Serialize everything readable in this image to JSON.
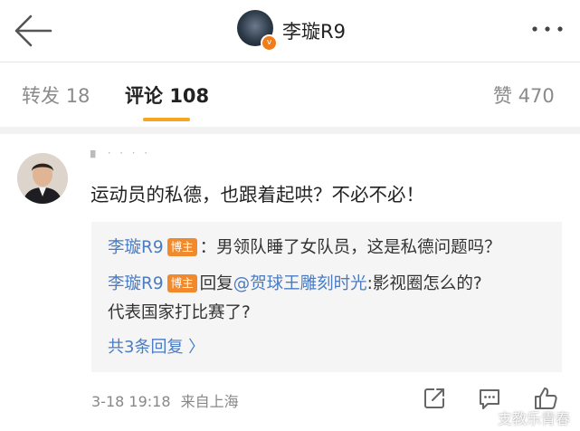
{
  "header": {
    "user_name": "李璇R9",
    "verified": true
  },
  "tabs": [
    {
      "label": "转发",
      "count": "18",
      "active": false
    },
    {
      "label": "评论",
      "count": "108",
      "active": true
    },
    {
      "label": "赞",
      "count": "470",
      "active": false
    }
  ],
  "comment": {
    "text": "运动员的私德，也跟着起哄？不必不必！",
    "replies": [
      {
        "author": "李璇R9",
        "badge": "博主",
        "text": "：男领队睡了女队员，这是私德问题吗？"
      },
      {
        "author": "李璇R9",
        "badge": "博主",
        "prefix": "回复",
        "mention": "@贺球王雕刻时光",
        "text": ":影视圈怎么的?",
        "text2": "代表国家打比赛了?"
      }
    ],
    "more_replies": "共3条回复 〉",
    "time": "3-18 19:18",
    "location": "来自上海"
  },
  "watermark": "支教乐青春",
  "colors": {
    "accent": "#f5a623",
    "link": "#4b7cc2",
    "badge": "#f08a2c"
  },
  "icons": [
    "back-arrow-icon",
    "more-dots-icon",
    "share-icon",
    "comment-icon",
    "like-icon",
    "weibo-icon"
  ]
}
